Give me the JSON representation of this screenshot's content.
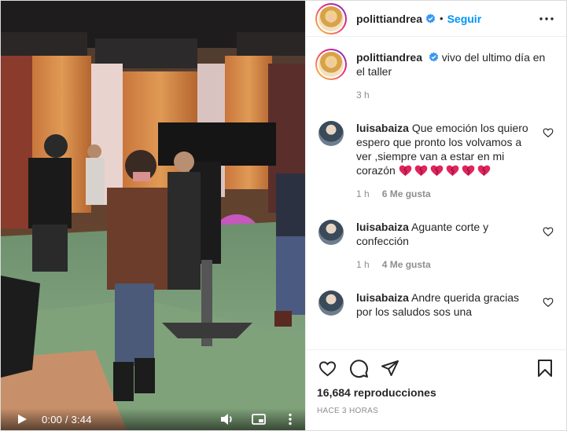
{
  "post": {
    "username": "polittiandrea",
    "follow_label": "Seguir",
    "dot": "•",
    "caption_text": "vivo del ultimo día en el taller",
    "caption_time": "3 h"
  },
  "comments": [
    {
      "username": "luisabaiza",
      "text": "Que emoción los quiero espero que pronto los volvamos a ver ,siempre van a estar en mi corazón",
      "emoji_count": 6,
      "time": "1 h",
      "likes": "6 Me gusta"
    },
    {
      "username": "luisabaiza",
      "text": "Aguante corte y confección",
      "time": "1 h",
      "likes": "4 Me gusta"
    },
    {
      "username": "luisabaiza",
      "text": "Andre querida gracias por los saludos sos una",
      "time": "",
      "likes": ""
    }
  ],
  "video": {
    "time_display": "0:00 / 3:44",
    "progress": 0
  },
  "stats": {
    "views": "16,684 reproducciones",
    "posted": "HACE 3 HORAS"
  },
  "icons": {
    "like": "heart-icon",
    "comment": "comment-bubble-icon",
    "share": "paper-plane-icon",
    "save": "bookmark-icon",
    "more": "more-horizontal-icon",
    "verified": "verified-badge-icon",
    "play": "play-icon",
    "volume": "volume-icon",
    "pip": "picture-in-picture-icon",
    "fullscreen": "fullscreen-icon",
    "video_more": "more-vertical-icon"
  },
  "colors": {
    "link_blue": "#0095f6",
    "muted": "#8e8e8e",
    "text": "#262626",
    "emoji_red": "#e0245e"
  }
}
